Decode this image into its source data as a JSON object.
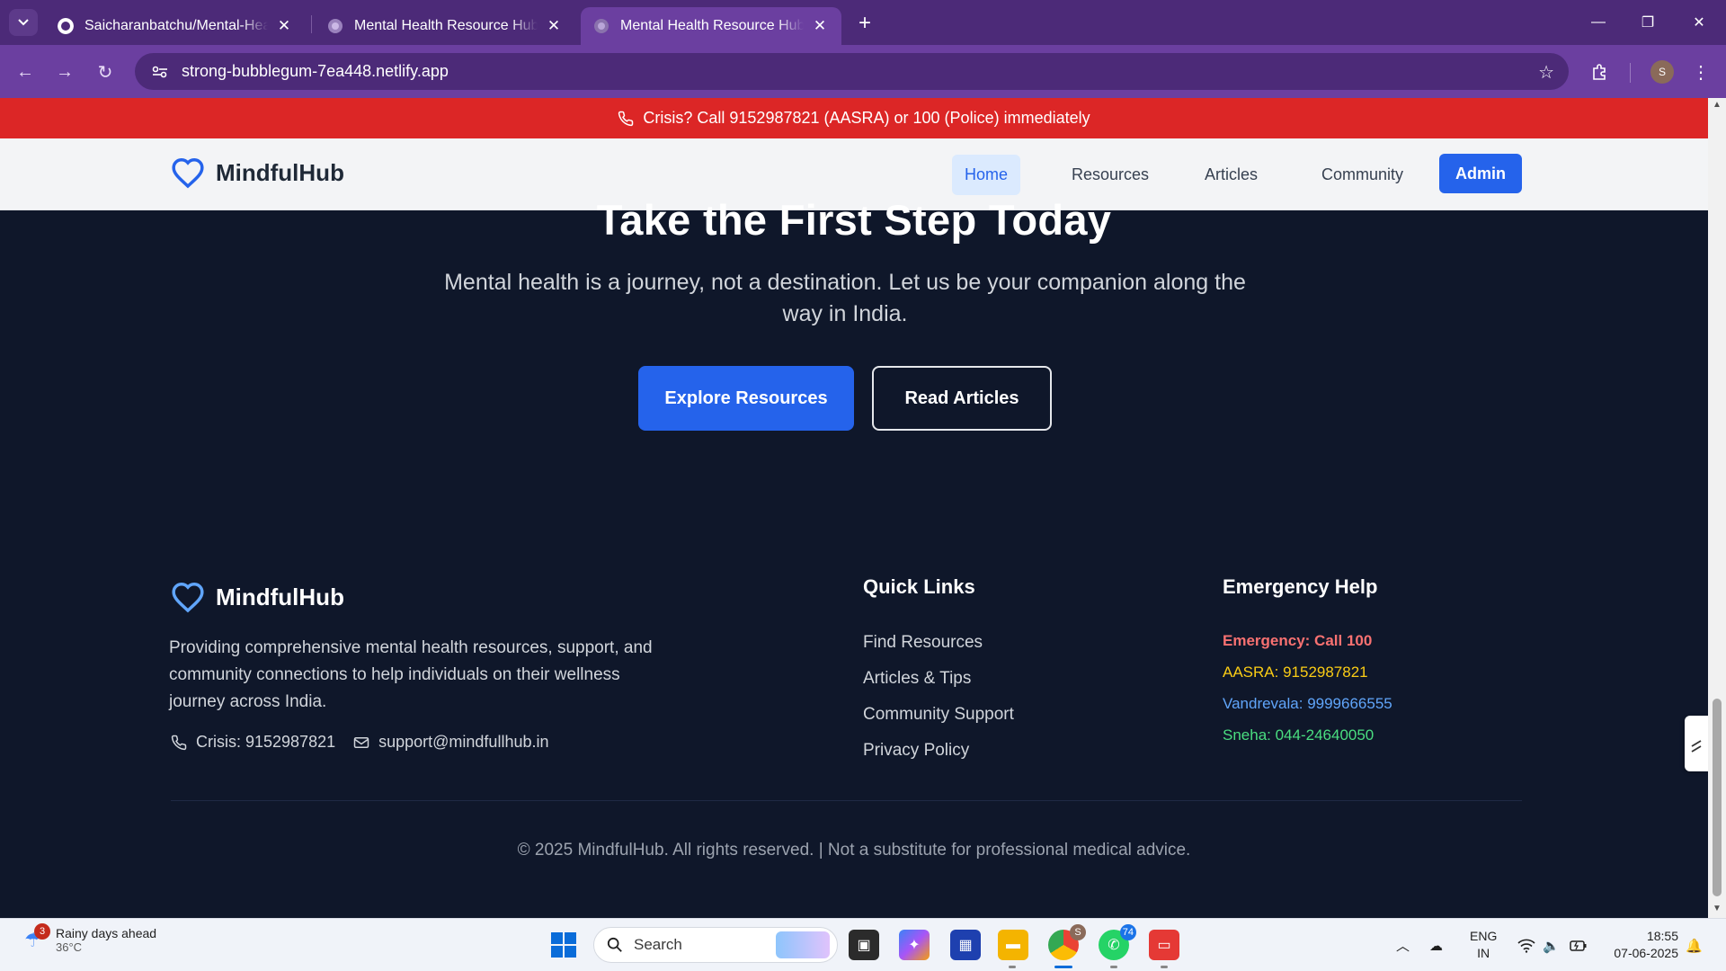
{
  "browser": {
    "tabs": [
      {
        "title": "Saicharanbatchu/Mental-Health",
        "favicon": "github-icon"
      },
      {
        "title": "Mental Health Resource Hub - S",
        "favicon": "globe-icon"
      },
      {
        "title": "Mental Health Resource Hub - S",
        "favicon": "globe-icon",
        "active": true
      }
    ],
    "url": "strong-bubblegum-7ea448.netlify.app",
    "profile_initial": "S",
    "colors": {
      "frame": "#4c2a78",
      "toolbar": "#6b3fa0"
    }
  },
  "site": {
    "crisis_banner": "Crisis? Call 9152987821 (AASRA) or 100 (Police) immediately",
    "brand": "MindfulHub",
    "nav": {
      "home": "Home",
      "resources": "Resources",
      "articles": "Articles",
      "community": "Community",
      "admin": "Admin"
    },
    "cta": {
      "title": "Take the First Step Today",
      "text": "Mental health is a journey, not a destination. Let us be your companion along the way in India.",
      "primary_button": "Explore Resources",
      "secondary_button": "Read Articles"
    },
    "footer": {
      "brand": "MindfulHub",
      "description": "Providing comprehensive mental health resources, support, and community connections to help individuals on their wellness journey across India.",
      "crisis_contact": "Crisis: 9152987821",
      "email": "support@mindfullhub.in",
      "quick_links_title": "Quick Links",
      "quick_links": [
        "Find Resources",
        "Articles & Tips",
        "Community Support",
        "Privacy Policy"
      ],
      "emergency_title": "Emergency Help",
      "emergency": [
        {
          "text": "Emergency: Call 100",
          "color": "#f87171"
        },
        {
          "text": "AASRA: 9152987821",
          "color": "#facc15"
        },
        {
          "text": "Vandrevala: 9999666555",
          "color": "#60a5fa"
        },
        {
          "text": "Sneha: 044-24640050",
          "color": "#4ade80"
        }
      ],
      "copyright": "© 2025 MindfulHub. All rights reserved. | Not a substitute for professional medical advice."
    },
    "colors": {
      "accent": "#2563eb",
      "crisis": "#dc2626",
      "background": "#0f172a"
    }
  },
  "taskbar": {
    "weather_title": "Rainy days ahead",
    "weather_temp": "36°C",
    "weather_badge": "3",
    "search_placeholder": "Search",
    "chrome_badge": "S",
    "whatsapp_badge": "74",
    "lang_top": "ENG",
    "lang_bottom": "IN",
    "time": "18:55",
    "date": "07-06-2025"
  }
}
